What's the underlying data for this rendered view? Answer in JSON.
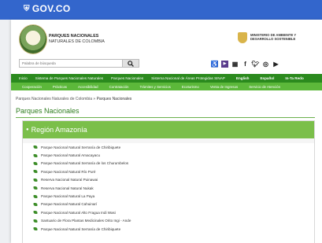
{
  "gov_bar": {
    "logo_text": "GOV.CO"
  },
  "brand": {
    "line1": "PARQUES NACIONALES",
    "line2": "NATURALES DE COLOMBIA"
  },
  "ministry": {
    "line1": "MINISTERIO DE AMBIENTE Y",
    "line2": "DESARROLLO SOSTENIBLE"
  },
  "search": {
    "placeholder": "Palabra de búsqueda"
  },
  "social_icons": [
    "accessibility-icon",
    "video-icon",
    "sitemap-icon",
    "facebook-icon",
    "twitter-icon",
    "instagram-icon",
    "youtube-icon"
  ],
  "nav_primary": {
    "items": [
      "Inicio",
      "Sistema de Parques Nacionales Naturales",
      "Parques Nacionales",
      "Sistema Nacional de Áreas Protegidas SINAP"
    ],
    "lang": [
      "English",
      "Español",
      "In-Ta Redo"
    ]
  },
  "nav_secondary": {
    "items": [
      "Cooperación",
      "Prácticas",
      "Accesibilidad",
      "Contratación",
      "Trámites y Servicios",
      "Ecoturismo",
      "Venta de Ingresos",
      "Servicio de Atención"
    ]
  },
  "breadcrumb": {
    "root": "Parques Nacionales Naturales de Colombia",
    "sep": "»",
    "current": "Parques Nacionales"
  },
  "page_title": "Parques Nacionales",
  "region": {
    "title": "Región Amazonía",
    "items": [
      "Parque Nacional Natural Serranía de Chiribiquete",
      "Parque Nacional Natural Amacayacu",
      "Parque Nacional Natural Serranía de los Churumbelos",
      "Parque Nacional Natural Río Puré",
      "Reserva Nacional Natural Puinawai",
      "Reserva Nacional Natural Nukak",
      "Parque Nacional Natural La Paya",
      "Parque Nacional Natural Cahuinarí",
      "Parque Nacional Natural Alto Fragua Indi Wasi",
      "Santuario de Flora Plantas Medicinales Orito Ingi - Ande",
      "Parque Nacional Natural Serranía de Chiribiquete"
    ]
  },
  "colors": {
    "gov_blue": "#3366cc",
    "nav_dark_green": "#2b8a1e",
    "nav_light_green": "#5cb83a",
    "region_header_green": "#7bbf4a",
    "title_green": "#2e7d1f"
  }
}
